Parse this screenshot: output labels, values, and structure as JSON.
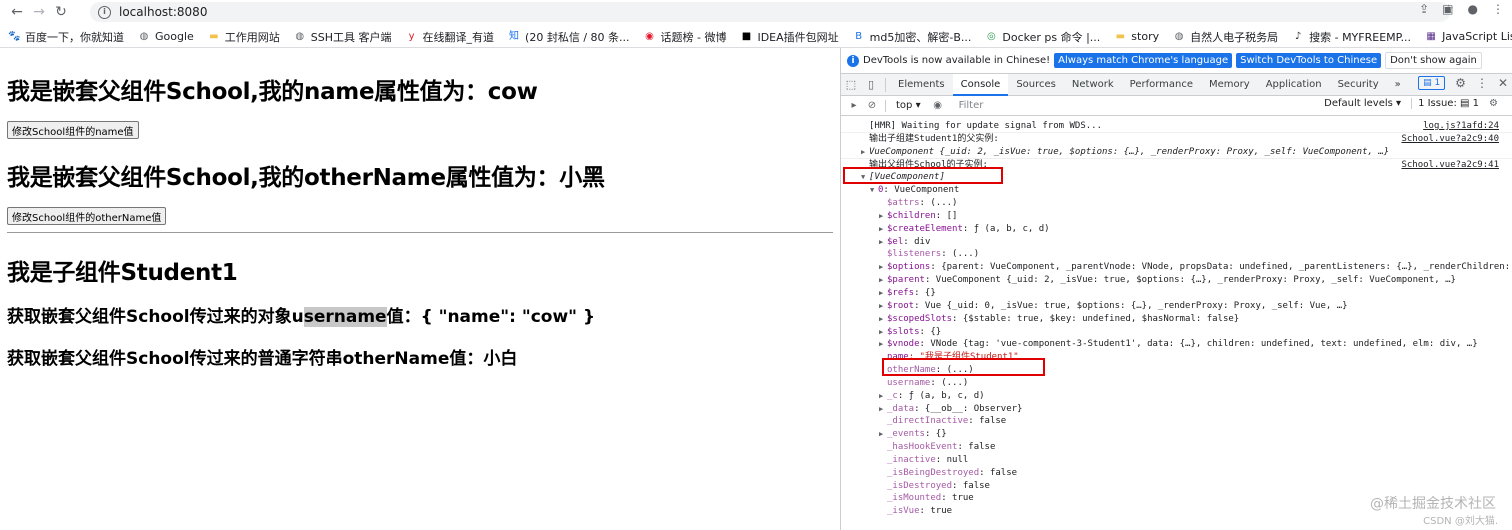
{
  "browser": {
    "url": "localhost:8080",
    "bookmarks": [
      {
        "label": "百度一下，你就知道",
        "icon": "paw-icon"
      },
      {
        "label": "Google",
        "icon": "globe-icon"
      },
      {
        "label": "工作用网站",
        "icon": "folder-icon"
      },
      {
        "label": "SSH工具 客户端",
        "icon": "globe-icon"
      },
      {
        "label": "在线翻译_有道",
        "icon": "youdao-icon"
      },
      {
        "label": "(20 封私信 / 80 条...",
        "icon": "zhihu-icon"
      },
      {
        "label": "话题榜 - 微博",
        "icon": "weibo-icon"
      },
      {
        "label": "IDEA插件包网址",
        "icon": "idea-icon"
      },
      {
        "label": "md5加密、解密-B...",
        "icon": "b-icon"
      },
      {
        "label": "Docker ps 命令 |...",
        "icon": "docker-icon"
      },
      {
        "label": "story",
        "icon": "folder-icon"
      },
      {
        "label": "自然人电子税务局",
        "icon": "globe-icon"
      },
      {
        "label": "搜索 - MYFREEMP...",
        "icon": "music-icon"
      },
      {
        "label": "JavaScript ListBox...",
        "icon": "grid-icon"
      }
    ]
  },
  "page": {
    "h1_name": "我是嵌套父组件School,我的name属性值为：cow",
    "btn_name": "修改School组件的name值",
    "h1_other": "我是嵌套父组件School,我的otherName属性值为：小黑",
    "btn_other": "修改School组件的otherName值",
    "h1_student": "我是子组件Student1",
    "line1_pre": "获取嵌套父组件School传过来的对象u",
    "line1_hl": "sername",
    "line1_post": "值：{ \"name\": \"cow\" }",
    "line2": "获取嵌套父组件School传过来的普通字符串otherName值：小白"
  },
  "devtools": {
    "info_text": "DevTools is now available in Chinese!",
    "info_primary1": "Always match Chrome's language",
    "info_primary2": "Switch DevTools to Chinese",
    "info_secondary": "Don't show again",
    "tabs": [
      "Elements",
      "Console",
      "Sources",
      "Network",
      "Performance",
      "Memory",
      "Application",
      "Security"
    ],
    "active_tab": "Console",
    "more": "»",
    "badge_count": "1",
    "context": "top",
    "filter_placeholder": "Filter",
    "levels": "Default levels",
    "issue": "1 Issue:",
    "issue_count": "1"
  },
  "console": {
    "rows": [
      {
        "indent": 0,
        "text": "[HMR] Waiting for update signal from WDS...",
        "src": "log.js?1afd:24",
        "msg": true
      },
      {
        "indent": 0,
        "text": "输出子组建Student1的父实例:",
        "src": "School.vue?a2c9:40",
        "msg": false
      },
      {
        "indent": 0,
        "tri": "▶",
        "text": "VueComponent {_uid: 2, _isVue: true, $options: {…}, _renderProxy: Proxy, _self: VueComponent, …}",
        "italic": true,
        "msg": true
      },
      {
        "indent": 0,
        "text": "输出父组件School的子实例:",
        "src": "School.vue?a2c9:41",
        "msg": false
      },
      {
        "indent": 0,
        "tri": "▼",
        "text": "[VueComponent]",
        "italic": true,
        "msg": false
      },
      {
        "indent": 1,
        "tri": "▼",
        "key": "0",
        "text": ": VueComponent",
        "msg": false
      },
      {
        "indent": 2,
        "key": "$attrs",
        "text": ": (...)",
        "msg": false
      },
      {
        "indent": 2,
        "tri": "▶",
        "key": "$children",
        "text": ": []",
        "msg": false
      },
      {
        "indent": 2,
        "tri": "▶",
        "key": "$createElement",
        "text": ": ƒ (a, b, c, d)",
        "msg": false
      },
      {
        "indent": 2,
        "tri": "▶",
        "key": "$el",
        "text": ": div",
        "msg": false
      },
      {
        "indent": 2,
        "key": "$listeners",
        "text": ": (...)",
        "msg": false
      },
      {
        "indent": 2,
        "tri": "▶",
        "key": "$options",
        "text": ": {parent: VueComponent, _parentVnode: VNode, propsData: undefined, _parentListeners: {…}, _renderChildren: u",
        "msg": false
      },
      {
        "indent": 2,
        "tri": "▶",
        "key": "$parent",
        "text": ": VueComponent {_uid: 2, _isVue: true, $options: {…}, _renderProxy: Proxy, _self: VueComponent, …}",
        "msg": false
      },
      {
        "indent": 2,
        "tri": "▶",
        "key": "$refs",
        "text": ": {}",
        "msg": false
      },
      {
        "indent": 2,
        "tri": "▶",
        "key": "$root",
        "text": ": Vue {_uid: 0, _isVue: true, $options: {…}, _renderProxy: Proxy, _self: Vue, …}",
        "msg": false
      },
      {
        "indent": 2,
        "tri": "▶",
        "key": "$scopedSlots",
        "text": ": {$stable: true, $key: undefined, $hasNormal: false}",
        "msg": false
      },
      {
        "indent": 2,
        "tri": "▶",
        "key": "$slots",
        "text": ": {}",
        "msg": false
      },
      {
        "indent": 2,
        "tri": "▶",
        "key": "$vnode",
        "text": ": VNode {tag: 'vue-component-3-Student1', data: {…}, children: undefined, text: undefined, elm: div, …}",
        "msg": false
      },
      {
        "indent": 2,
        "key": "name",
        "text": ": \"我是子组件Student1\"",
        "str": true,
        "msg": false
      },
      {
        "indent": 2,
        "key": "otherName",
        "text": ": (...)",
        "msg": false
      },
      {
        "indent": 2,
        "key": "username",
        "text": ": (...)",
        "msg": false
      },
      {
        "indent": 2,
        "tri": "▶",
        "key": "_c",
        "text": ": ƒ (a, b, c, d)",
        "msg": false
      },
      {
        "indent": 2,
        "tri": "▶",
        "key": "_data",
        "text": ": {__ob__: Observer}",
        "msg": false
      },
      {
        "indent": 2,
        "key": "_directInactive",
        "text": ": false",
        "msg": false
      },
      {
        "indent": 2,
        "tri": "▶",
        "key": "_events",
        "text": ": {}",
        "msg": false
      },
      {
        "indent": 2,
        "key": "_hasHookEvent",
        "text": ": false",
        "msg": false
      },
      {
        "indent": 2,
        "key": "_inactive",
        "text": ": null",
        "msg": false
      },
      {
        "indent": 2,
        "key": "_isBeingDestroyed",
        "text": ": false",
        "msg": false
      },
      {
        "indent": 2,
        "key": "_isDestroyed",
        "text": ": false",
        "msg": false
      },
      {
        "indent": 2,
        "key": "_isMounted",
        "text": ": true",
        "msg": false
      },
      {
        "indent": 2,
        "key": "_isVue",
        "text": ": true",
        "msg": false
      }
    ]
  },
  "watermark": {
    "main": "@稀土掘金技术社区",
    "sub": "CSDN @刘大猫."
  }
}
